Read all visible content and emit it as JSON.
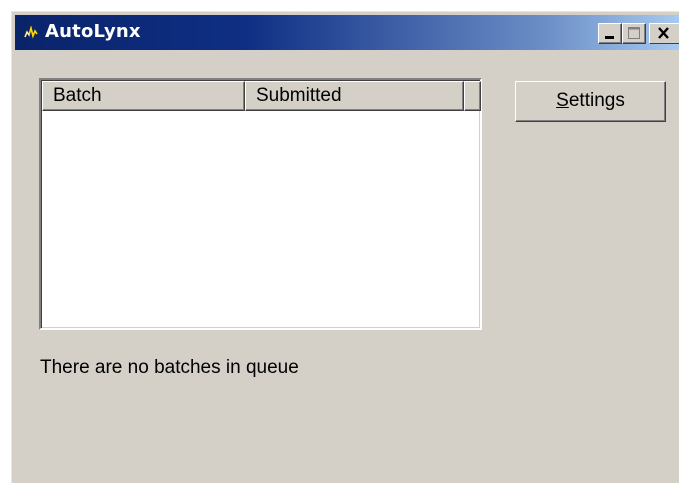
{
  "window": {
    "title": "AutoLynx",
    "icon": "autolynx-app-icon",
    "controls": {
      "minimize_icon": "minimize-icon",
      "maximize_icon": "maximize-icon",
      "close_icon": "close-icon"
    }
  },
  "batch_list": {
    "columns": [
      "Batch",
      "Submitted"
    ],
    "rows": []
  },
  "settings_button": {
    "accelerator": "S",
    "label_rest": "ettings"
  },
  "status": {
    "message": "There are no batches in queue"
  },
  "colors": {
    "window_face": "#d4d0c8",
    "titlebar_start": "#0a246a",
    "titlebar_end": "#a6caf0",
    "title_text": "#ffffff"
  }
}
